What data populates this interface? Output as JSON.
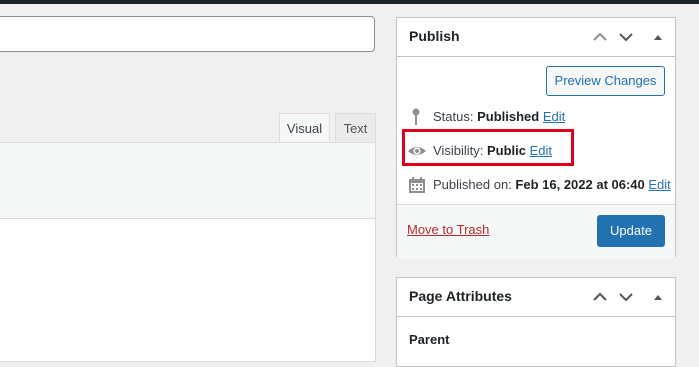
{
  "editor": {
    "tabs": [
      {
        "label": "Visual",
        "active": true
      },
      {
        "label": "Text",
        "active": false
      }
    ]
  },
  "publish": {
    "title": "Publish",
    "preview_label": "Preview Changes",
    "status": {
      "icon": "pin-icon",
      "label": "Status:",
      "value": "Published",
      "edit": "Edit"
    },
    "visibility": {
      "icon": "eye-icon",
      "label": "Visibility:",
      "value": "Public",
      "edit": "Edit"
    },
    "date": {
      "icon": "calendar-icon",
      "label": "Published on:",
      "value": "Feb 16, 2022 at 06:40",
      "edit": "Edit"
    },
    "trash_label": "Move to Trash",
    "update_label": "Update"
  },
  "page_attributes": {
    "title": "Page Attributes",
    "parent_label": "Parent"
  },
  "colors": {
    "accent": "#2271b1",
    "danger": "#b32d2e",
    "highlight": "#e0001b"
  }
}
